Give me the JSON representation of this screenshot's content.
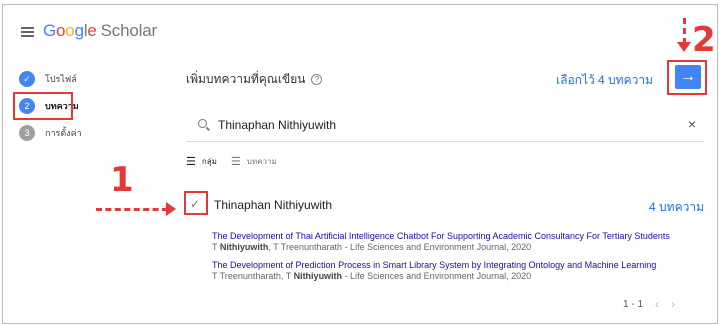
{
  "header": {
    "logo_text": "Google",
    "product": "Scholar"
  },
  "sidebar": {
    "steps": [
      {
        "label": "โปรไฟล์",
        "state": "done"
      },
      {
        "label": "บทความ",
        "state": "active",
        "number": "2"
      },
      {
        "label": "การตั้งค่า",
        "state": "idle",
        "number": "3"
      }
    ]
  },
  "main": {
    "title": "เพิ่มบทความที่คุณเขียน",
    "help_glyph": "?",
    "selected_text": "เลือกไว้ 4 บทความ",
    "next_arrow": "→",
    "search": {
      "value": "Thinaphan Nithiyuwith",
      "clear": "×"
    },
    "tabs": [
      {
        "label": "กลุ่ม",
        "active": true
      },
      {
        "label": "บทความ",
        "active": false
      }
    ],
    "group": {
      "check_glyph": "✓",
      "author": "Thinaphan Nithiyuwith",
      "count": "4 บทความ",
      "papers": [
        {
          "title": "The Development of Thai Artificial Intelligence Chatbot For Supporting Academic Consultancy For Tertiary Students",
          "authors_prefix": "T ",
          "authors_bold": "Nithiyuwith",
          "authors_suffix": ", T Treenuntharath - Life Sciences and Environment Journal, 2020"
        },
        {
          "title": "The Development of Prediction Process in Smart Library System by Integrating Ontology and Machine Learning",
          "authors_prefix": "T Treenuntharath, T ",
          "authors_bold": "Nithiyuwith",
          "authors_suffix": " - Life Sciences and Environment Journal, 2020"
        }
      ]
    },
    "pager": {
      "range": "1 - 1",
      "prev": "‹",
      "next": "›"
    }
  },
  "annotations": {
    "one": "1",
    "two": "2"
  },
  "colors": {
    "accent": "#4285f4",
    "annotation": "#e53935",
    "link": "#1a0dab"
  }
}
